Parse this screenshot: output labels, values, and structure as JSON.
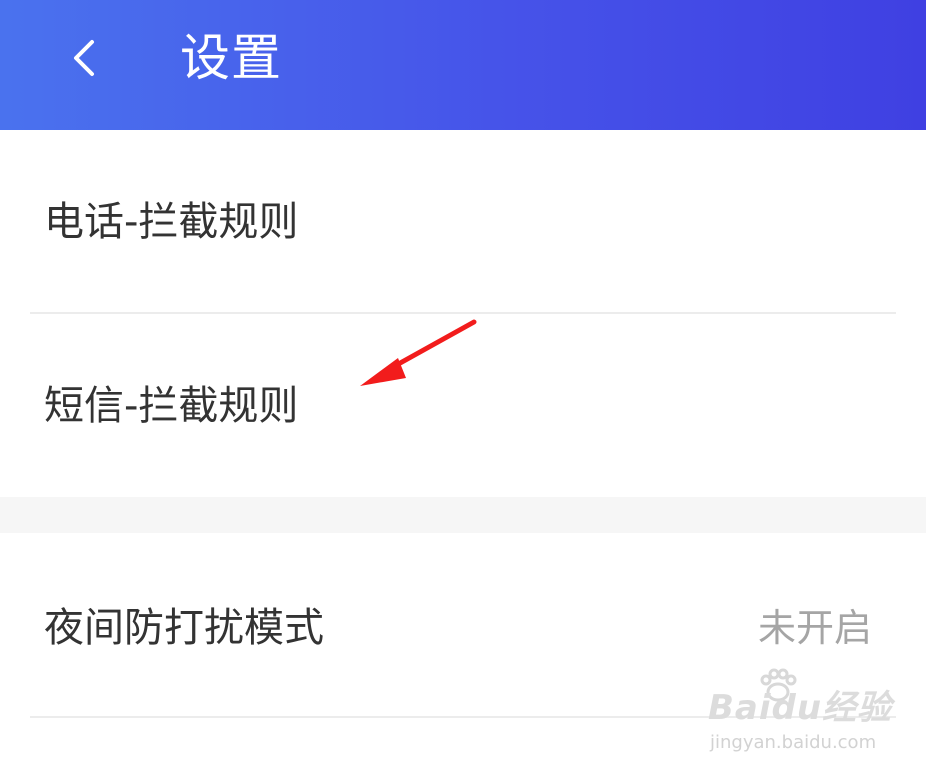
{
  "header": {
    "title": "设置",
    "back_icon": "chevron-left-icon",
    "gradient": [
      "#4a72ee",
      "#3f40e2"
    ]
  },
  "settings": {
    "call_rules_label": "电话-拦截规则",
    "sms_rules_label": "短信-拦截规则",
    "night_mode_label": "夜间防打扰模式",
    "night_mode_value": "未开启"
  },
  "annotation": {
    "arrow_color": "#f21c1c",
    "arrow_icon": "red-arrow-icon"
  },
  "watermark": {
    "logo_text": "Baidu经验",
    "url_text": "jingyan.baidu.com"
  }
}
